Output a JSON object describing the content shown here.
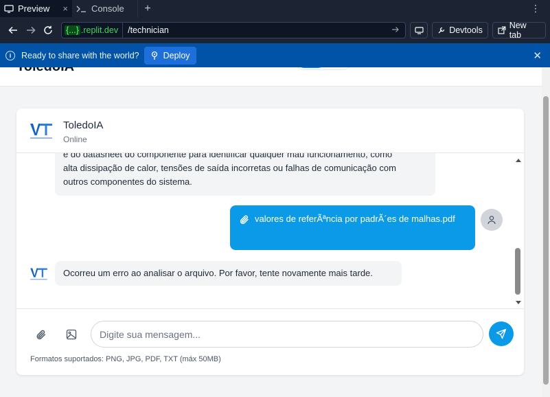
{
  "browser": {
    "tabs": [
      {
        "label": "Preview",
        "active": true
      },
      {
        "label": "Console",
        "active": false
      }
    ],
    "close_glyph": "×",
    "add_tab_glyph": "+",
    "menu_glyph": "⋮",
    "address": {
      "braces": "{...}",
      "host": ".replit.dev",
      "path": "/technician"
    },
    "buttons": {
      "devtools": "Devtools",
      "new_tab": "New tab"
    }
  },
  "banner": {
    "message": "Ready to share with the world?",
    "deploy_label": "Deploy",
    "info_glyph": "i",
    "close_glyph": "✕"
  },
  "app": {
    "brand": "ToledoIA",
    "colors": {
      "primary": "#0b9ae8",
      "logo_blue": "#1565c0"
    }
  },
  "chat": {
    "title": "ToledoIA",
    "status": "Online",
    "messages": [
      {
        "role": "bot",
        "lines": [
          "e do datasheet do componente para identificar qualquer mau funcionamento, como",
          "alta dissipação de calor, tensões de saída incorretas ou falhas de comunicação com",
          "outros componentes do sistema."
        ]
      },
      {
        "role": "user",
        "attachment": "valores de referÃªncia por padrÃ´es de malhas.pdf"
      },
      {
        "role": "bot",
        "text": "Ocorreu um erro ao analisar o arquivo. Por favor, tente novamente mais tarde."
      }
    ],
    "input_placeholder": "Digite sua mensagem...",
    "input_value": "",
    "formats_note": "Formatos suportados: PNG, JPG, PDF, TXT (máx 50MB)"
  }
}
